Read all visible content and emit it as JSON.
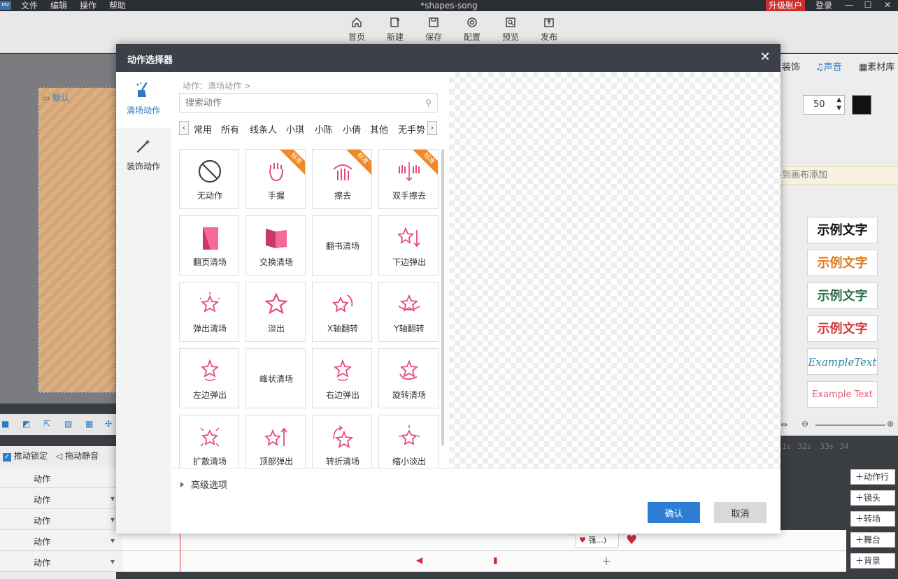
{
  "app": {
    "logo": "MV",
    "title": "*shapes-song",
    "menus": [
      "文件",
      "编辑",
      "操作",
      "帮助"
    ],
    "upgrade": "升级账户",
    "login": "登录"
  },
  "toolbar": {
    "items": [
      "首页",
      "新建",
      "保存",
      "配置",
      "预览",
      "发布"
    ]
  },
  "canvas": {
    "label": "默认"
  },
  "right": {
    "tabs": [
      "装饰",
      "声音",
      "素材库"
    ],
    "number": "50",
    "hint": "到画布添加",
    "samples": [
      "示例文字",
      "示例文字",
      "示例文字",
      "示例文字",
      "ExampleText",
      "Example Text"
    ],
    "ruler": [
      "1s",
      "32s",
      "33s",
      "34"
    ],
    "add_buttons": [
      "动作行",
      "镜头",
      "转场",
      "舞台",
      "背景"
    ]
  },
  "timeline": {
    "lock": "推动锁定",
    "mute": "拖动静音",
    "rows": [
      "动作",
      "动作",
      "动作",
      "动作",
      "动作"
    ],
    "clip_text": "强...)"
  },
  "dialog": {
    "title": "动作选择器",
    "close": "✕",
    "side": [
      "清场动作",
      "装饰动作"
    ],
    "breadcrumb": "动作：清场动作 >",
    "search_placeholder": "搜索动作",
    "categories": [
      "常用",
      "所有",
      "线条人",
      "小琪",
      "小陈",
      "小倩",
      "其他",
      "无手势"
    ],
    "ribbon": "标准",
    "actions": [
      "无动作",
      "手握",
      "擦去",
      "双手擦去",
      "翻页清场",
      "交换清场",
      "翻书清场",
      "下边弹出",
      "弹出清场",
      "淡出",
      "X轴翻转",
      "Y轴翻转",
      "左边弹出",
      "峰状清场",
      "右边弹出",
      "旋转清场",
      "扩散清场",
      "顶部弹出",
      "转折清场",
      "缩小淡出"
    ],
    "advanced": "高级选项",
    "ok": "确认",
    "cancel": "取消"
  },
  "colors": {
    "accent": "#2d7dd2",
    "pink": "#e84a7f",
    "ribbon": "#f08a24",
    "header": "#3b4049"
  }
}
